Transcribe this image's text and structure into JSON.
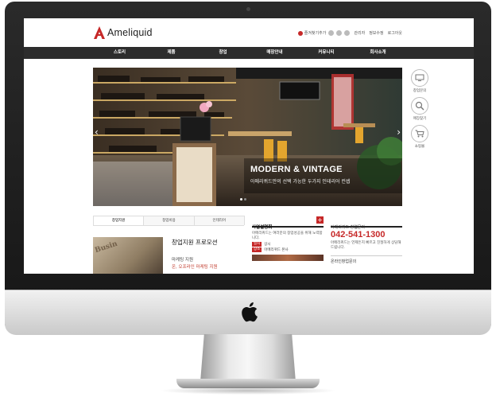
{
  "site": {
    "logo_text": "Ameliquid",
    "utility": {
      "favorite_label": "즐겨찾기추가",
      "links": [
        "관리자",
        "정보수정",
        "로그아웃"
      ]
    },
    "nav": [
      "스토리",
      "제품",
      "창업",
      "매장안내",
      "커뮤니티",
      "회사소개"
    ],
    "hero": {
      "title": "MODERN & VINTAGE",
      "subtitle": "아메리퀴드만의 선택 가능한 두가지 인테리어 컨셉",
      "prev_glyph": "‹",
      "next_glyph": "›"
    },
    "quick_menu": [
      {
        "label": "창업문의",
        "icon": "monitor-icon"
      },
      {
        "label": "매장찾기",
        "icon": "search-icon"
      },
      {
        "label": "쇼핑몰",
        "icon": "cart-icon"
      }
    ],
    "tabs": [
      "창업지원",
      "창업비용",
      "인테리어"
    ],
    "promo": {
      "image_text": "Busin",
      "title": "창업지원 프로모션",
      "line1": "마케팅 지원",
      "line2": "온, 오프라인 마케팅 지원"
    },
    "briefing": {
      "title": "사업설명회",
      "plus": "+",
      "text": "아메리퀴드는 여러분의 창업성공을 위해 노력합니다.",
      "rows": [
        {
          "badge": "일시",
          "value": "상시"
        },
        {
          "badge": "장소",
          "value": "아메리퀴드 본사"
        }
      ]
    },
    "consult": {
      "title": "아메리퀴드 창업문의",
      "phone": "042-541-1300",
      "text": "아메리퀴드는 언제든지 빠르고 친절하게 상담해 드립니다.",
      "online": "온라인창업문의"
    }
  },
  "colors": {
    "accent": "#c62828",
    "nav_bg": "#2d2d2d",
    "bezel": "#1e1e1e"
  }
}
